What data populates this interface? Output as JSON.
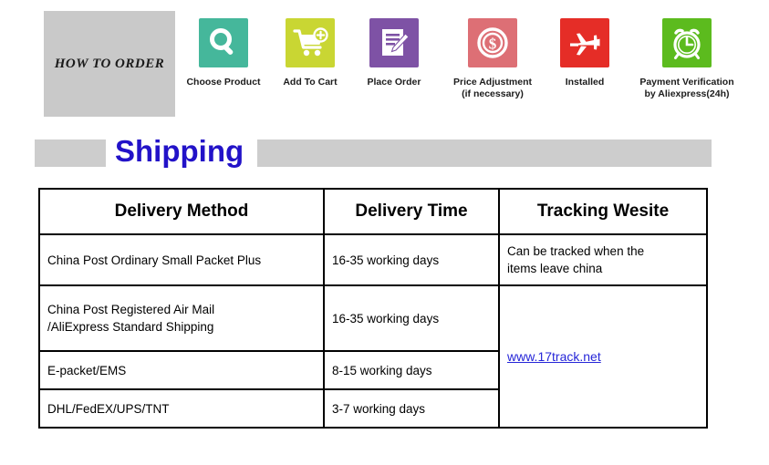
{
  "how_to_order": {
    "badge_label": "HOW TO ORDER",
    "steps": [
      {
        "icon": "search-icon",
        "label": "Choose Product",
        "color": "#45b79b"
      },
      {
        "icon": "shopping-cart-plus-icon",
        "label": "Add To Cart",
        "color": "#c9d633"
      },
      {
        "icon": "document-pen-icon",
        "label": "Place Order",
        "color": "#8martin"
      },
      {
        "icon": "dollar-coin-icon",
        "label": "Price  Adjustment\n(if necessary)",
        "color": "#dd6f75"
      },
      {
        "icon": "airplane-icon",
        "label": "Installed",
        "color": "#e52d27"
      },
      {
        "icon": "alarm-clock-icon",
        "label": "Payment Verification\nby Aliexpress(24h)",
        "color": "#5cbb1e"
      }
    ]
  },
  "shipping": {
    "title": "Shipping",
    "title_color": "#2212c8",
    "table": {
      "headers": [
        "Delivery Method",
        "Delivery Time",
        "Tracking Wesite"
      ],
      "rows": [
        {
          "method": "China Post Ordinary Small Packet Plus",
          "time": "16-35 working days",
          "tracking": "Can be tracked when the\nitems leave china"
        },
        {
          "method": "China Post Registered Air Mail\n/AliExpress Standard Shipping",
          "time": "16-35 working days"
        },
        {
          "method": "E-packet/EMS",
          "time": "8-15 working days"
        },
        {
          "method": "DHL/FedEX/UPS/TNT",
          "time": "3-7 working days"
        }
      ],
      "tracking_link": "www.17track.net"
    }
  }
}
